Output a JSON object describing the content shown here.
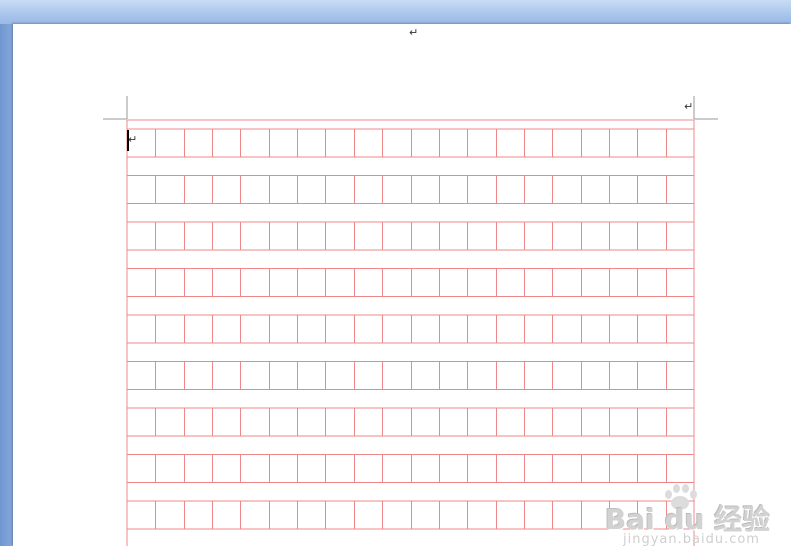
{
  "window": {
    "paragraph_mark_glyph": "↵"
  },
  "page": {
    "header_mark": "↵",
    "body_mark": "↵"
  },
  "grid": {
    "rows": 9,
    "columns": 20,
    "line_color": "#ee8888"
  },
  "watermark": {
    "logo_text": "Bai du 经验",
    "url_text": "jingyan.baidu.com"
  }
}
